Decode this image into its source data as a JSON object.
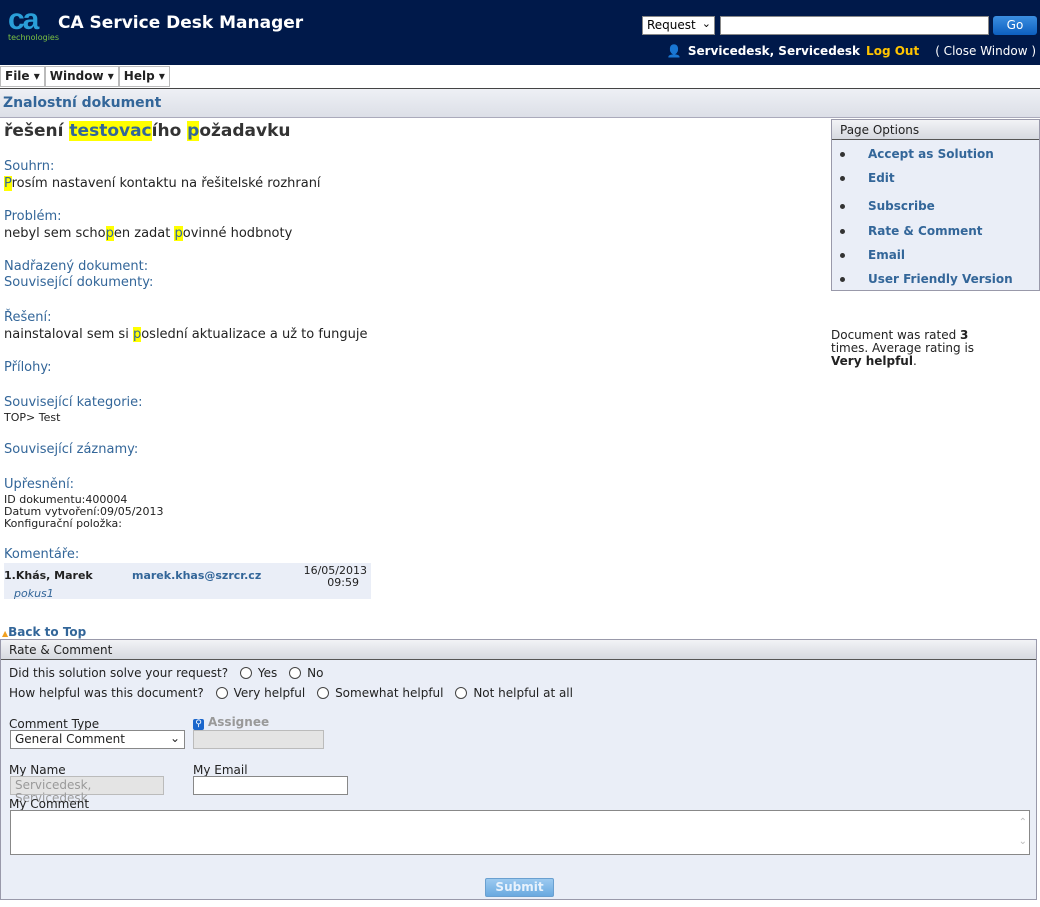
{
  "header": {
    "logo_text": "ca",
    "logo_sub": "technologies",
    "app_title": "CA Service Desk Manager",
    "search_type": "Request",
    "search_value": "",
    "go_label": "Go",
    "user_name": "Servicedesk, Servicedesk",
    "logout_label": "Log Out",
    "close_window_label": "( Close Window )"
  },
  "menu": [
    {
      "label": "File"
    },
    {
      "label": "Window"
    },
    {
      "label": "Help"
    }
  ],
  "page_title": "Znalostní dokument",
  "document": {
    "title_segments": [
      {
        "t": "řešení ",
        "h": false
      },
      {
        "t": "testovac",
        "h": true
      },
      {
        "t": "ího ",
        "h": false
      },
      {
        "t": "p",
        "h": true
      },
      {
        "t": "ožadavku",
        "h": false
      }
    ],
    "summary_label": "Souhrn:",
    "summary_segments": [
      {
        "t": "P",
        "h": true
      },
      {
        "t": "rosím nastavení kontaktu na řešitelské rozhraní",
        "h": false
      }
    ],
    "problem_label": "Problém:",
    "problem_segments": [
      {
        "t": "nebyl sem scho",
        "h": false
      },
      {
        "t": "p",
        "h": true
      },
      {
        "t": "en zadat ",
        "h": false
      },
      {
        "t": "p",
        "h": true
      },
      {
        "t": "ovinné hodbnoty",
        "h": false
      }
    ],
    "parent_label": "Nadřazený dokument:",
    "related_docs_label": "Související dokumenty:",
    "solution_label": "Řešení:",
    "solution_segments": [
      {
        "t": "nainstaloval sem si ",
        "h": false
      },
      {
        "t": "p",
        "h": true
      },
      {
        "t": "oslední aktualizace a už to funguje",
        "h": false
      }
    ],
    "attachments_label": "Přílohy:",
    "categories_label": "Související kategorie:",
    "category_value": "TOP> Test",
    "records_label": "Související záznamy:",
    "details_label": "Upřesnění:",
    "doc_id": "ID dokumentu:400004",
    "created": "Datum vytvoření:09/05/2013",
    "config_item": "Konfigurační položka:",
    "comments_label": "Komentáře:",
    "comment": {
      "author": "1.Khás, Marek",
      "email": "marek.khas@szrcr.cz",
      "date": "16/05/2013",
      "time": "09:59",
      "text": "pokus1"
    }
  },
  "page_options": {
    "title": "Page Options",
    "items": [
      {
        "label": "Accept as Solution"
      },
      {
        "label": "Edit"
      },
      {
        "label": "Subscribe"
      },
      {
        "label": "Rate & Comment"
      },
      {
        "label": "Email"
      },
      {
        "label": "User Friendly Version"
      }
    ]
  },
  "rating": {
    "pre": "Document was rated ",
    "count": "3",
    "mid": " times. Average rating is ",
    "value": "Very helpful",
    "post": "."
  },
  "back_to_top": "Back to Top",
  "rate_comment": {
    "title": "Rate & Comment",
    "q1": "Did this solution solve your request?",
    "q1_options": [
      "Yes",
      "No"
    ],
    "q2": "How helpful was this document?",
    "q2_options": [
      "Very helpful",
      "Somewhat helpful",
      "Not helpful at all"
    ],
    "comment_type_label": "Comment Type",
    "comment_type_value": "General Comment",
    "assignee_label": "Assignee",
    "my_name_label": "My Name",
    "my_name_value": "Servicedesk, Servicedesk",
    "my_email_label": "My Email",
    "my_comment_label": "My Comment",
    "submit_label": "Submit"
  },
  "colors": {
    "header_bg": "#00194a",
    "link": "#336699",
    "highlight": "#ffff00",
    "logout": "#ffc400",
    "panel_bg": "#eaeef7"
  }
}
